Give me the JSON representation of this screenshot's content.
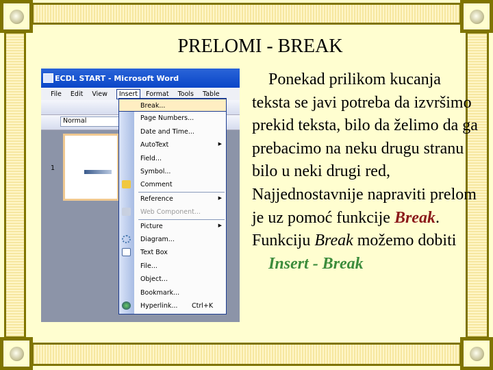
{
  "title": "PRELOMI - BREAK",
  "body": {
    "p1": "Ponekad prilikom kucanja teksta se javi potreba da izvršimo prekid teksta, bilo da želimo da ga prebacimo na neku drugu stranu bilo u neki drugi red, Najjednostavnije napraviti prelom je uz pomoć funkcije ",
    "break_red": "Break",
    "p2": ". Funkciju ",
    "break_italic": "Break",
    "p3": " možemo dobiti",
    "insert_break": "Insert  - Break"
  },
  "screenshot": {
    "window_title": "ECDL START - Microsoft Word",
    "menus": [
      "File",
      "Edit",
      "View",
      "Insert",
      "Format",
      "Tools",
      "Table"
    ],
    "style": "Normal",
    "page_number": "1",
    "insert_menu": [
      {
        "label": "Break...",
        "highlighted": true
      },
      {
        "label": "Page Numbers..."
      },
      {
        "label": "Date and Time..."
      },
      {
        "label": "AutoText",
        "submenu": true
      },
      {
        "label": "Field..."
      },
      {
        "label": "Symbol..."
      },
      {
        "label": "Comment",
        "icon": "comment-icon"
      },
      {
        "label": "Reference",
        "submenu": true
      },
      {
        "label": "Web Component...",
        "disabled": true,
        "icon": "web-component-icon"
      },
      {
        "label": "Picture",
        "submenu": true
      },
      {
        "label": "Diagram...",
        "icon": "diagram-icon"
      },
      {
        "label": "Text Box",
        "icon": "text-box-icon"
      },
      {
        "label": "File..."
      },
      {
        "label": "Object..."
      },
      {
        "label": "Bookmark..."
      },
      {
        "label": "Hyperlink...",
        "shortcut": "Ctrl+K",
        "icon": "hyperlink-icon"
      }
    ]
  },
  "colors": {
    "frame": "#7f7400",
    "background": "#fffed0",
    "red": "#8b1a1a",
    "green": "#3c8c3c"
  }
}
